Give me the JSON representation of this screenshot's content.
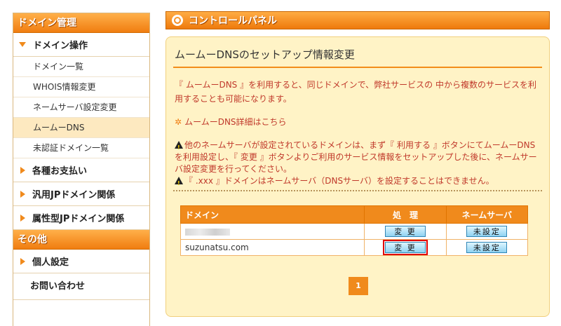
{
  "sidebar": {
    "head1": "ドメイン管理",
    "section_domain": "ドメイン操作",
    "sub": [
      "ドメイン一覧",
      "WHOIS情報変更",
      "ネームサーバ設定変更",
      "ムームーDNS",
      "未認証ドメイン一覧"
    ],
    "active_index": 3,
    "section_payment": "各種お支払い",
    "section_jp": "汎用JPドメイン関係",
    "section_attr": "属性型JPドメイン関係",
    "head2": "その他",
    "section_personal": "個人設定",
    "contact": "お問い合わせ"
  },
  "header": {
    "title": "コントロールパネル"
  },
  "main": {
    "title": "ムームーDNSのセットアップ情報変更",
    "intro": "『 ムームーDNS 』を利用すると、同じドメインで、弊社サービスの 中から複数のサービスを利用することも可能になります。",
    "link": "ムームーDNS詳細はこちら",
    "warning1": "他のネームサーバが設定されているドメインは、まず『 利用する 』ボタンにてムームーDNSを利用設定し、『 変更 』ボタンよりご利用のサービス情報をセットアップした後に、ネームサーバ設定変更を行ってください。",
    "warning2": "『 .xxx 』ドメインはネームサーバ（DNSサーバ）を設定することはできません。"
  },
  "table": {
    "headers": {
      "domain": "ドメイン",
      "action": "処　理",
      "ns": "ネームサーバ"
    },
    "rows": [
      {
        "domain": "",
        "action": "変 更",
        "ns": "未設定"
      },
      {
        "domain": "suzunatsu.com",
        "action": "変 更",
        "ns": "未設定"
      }
    ]
  },
  "pager": {
    "page": "1"
  },
  "colors": {
    "accent": "#f08a1c",
    "panel_bg": "#fff3c6",
    "warning_text": "#c0392b",
    "button": "#8fd2f2"
  }
}
